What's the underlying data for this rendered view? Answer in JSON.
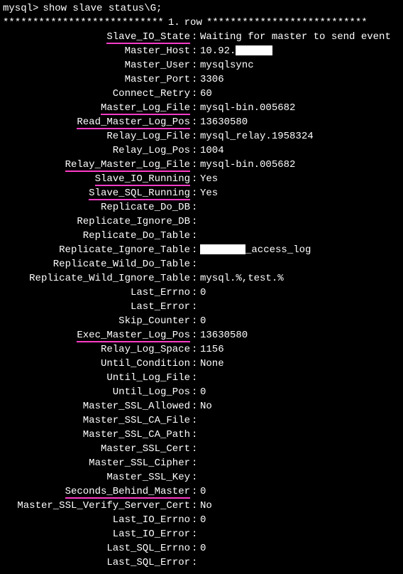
{
  "prompt_prefix": "mysql>",
  "command": "show slave status\\G;",
  "separator": {
    "prefix": "***************************",
    "num": "1.",
    "rowword": "row",
    "suffix": "***************************"
  },
  "rows": [
    {
      "label": "Slave_IO_State",
      "value": "Waiting for master to send event",
      "hl": true,
      "redact": false
    },
    {
      "label": "Master_Host",
      "value": "10.92.",
      "hl": false,
      "redact": true,
      "redact_w": 52
    },
    {
      "label": "Master_User",
      "value": "mysqlsync",
      "hl": false,
      "redact": false
    },
    {
      "label": "Master_Port",
      "value": "3306",
      "hl": false,
      "redact": false
    },
    {
      "label": "Connect_Retry",
      "value": "60",
      "hl": false,
      "redact": false
    },
    {
      "label": "Master_Log_File",
      "value": "mysql-bin.005682",
      "hl": true,
      "redact": false
    },
    {
      "label": "Read_Master_Log_Pos",
      "value": "13630580",
      "hl": true,
      "redact": false
    },
    {
      "label": "Relay_Log_File",
      "value": "mysql_relay.1958324",
      "hl": false,
      "redact": false
    },
    {
      "label": "Relay_Log_Pos",
      "value": "1004",
      "hl": false,
      "redact": false
    },
    {
      "label": "Relay_Master_Log_File",
      "value": "mysql-bin.005682",
      "hl": true,
      "redact": false
    },
    {
      "label": "Slave_IO_Running",
      "value": "Yes",
      "hl": true,
      "redact": false
    },
    {
      "label": "Slave_SQL_Running",
      "value": "Yes",
      "hl": true,
      "redact": false
    },
    {
      "label": "Replicate_Do_DB",
      "value": "",
      "hl": false,
      "redact": false
    },
    {
      "label": "Replicate_Ignore_DB",
      "value": "",
      "hl": false,
      "redact": false
    },
    {
      "label": "Replicate_Do_Table",
      "value": "",
      "hl": false,
      "redact": false
    },
    {
      "label": "Replicate_Ignore_Table",
      "value": "_access_log",
      "hl": false,
      "redact": true,
      "redact_w": 64,
      "redact_before": true
    },
    {
      "label": "Replicate_Wild_Do_Table",
      "value": "",
      "hl": false,
      "redact": false
    },
    {
      "label": "Replicate_Wild_Ignore_Table",
      "value": "mysql.%,test.%",
      "hl": false,
      "redact": false
    },
    {
      "label": "Last_Errno",
      "value": "0",
      "hl": false,
      "redact": false
    },
    {
      "label": "Last_Error",
      "value": "",
      "hl": false,
      "redact": false
    },
    {
      "label": "Skip_Counter",
      "value": "0",
      "hl": false,
      "redact": false
    },
    {
      "label": "Exec_Master_Log_Pos",
      "value": "13630580",
      "hl": true,
      "redact": false
    },
    {
      "label": "Relay_Log_Space",
      "value": "1156",
      "hl": false,
      "redact": false
    },
    {
      "label": "Until_Condition",
      "value": "None",
      "hl": false,
      "redact": false
    },
    {
      "label": "Until_Log_File",
      "value": "",
      "hl": false,
      "redact": false
    },
    {
      "label": "Until_Log_Pos",
      "value": "0",
      "hl": false,
      "redact": false
    },
    {
      "label": "Master_SSL_Allowed",
      "value": "No",
      "hl": false,
      "redact": false
    },
    {
      "label": "Master_SSL_CA_File",
      "value": "",
      "hl": false,
      "redact": false
    },
    {
      "label": "Master_SSL_CA_Path",
      "value": "",
      "hl": false,
      "redact": false
    },
    {
      "label": "Master_SSL_Cert",
      "value": "",
      "hl": false,
      "redact": false
    },
    {
      "label": "Master_SSL_Cipher",
      "value": "",
      "hl": false,
      "redact": false
    },
    {
      "label": "Master_SSL_Key",
      "value": "",
      "hl": false,
      "redact": false
    },
    {
      "label": "Seconds_Behind_Master",
      "value": "0",
      "hl": true,
      "redact": false
    },
    {
      "label": "Master_SSL_Verify_Server_Cert",
      "value": "No",
      "hl": false,
      "redact": false
    },
    {
      "label": "Last_IO_Errno",
      "value": "0",
      "hl": false,
      "redact": false
    },
    {
      "label": "Last_IO_Error",
      "value": "",
      "hl": false,
      "redact": false
    },
    {
      "label": "Last_SQL_Errno",
      "value": "0",
      "hl": false,
      "redact": false
    },
    {
      "label": "Last_SQL_Error",
      "value": "",
      "hl": false,
      "redact": false
    }
  ]
}
